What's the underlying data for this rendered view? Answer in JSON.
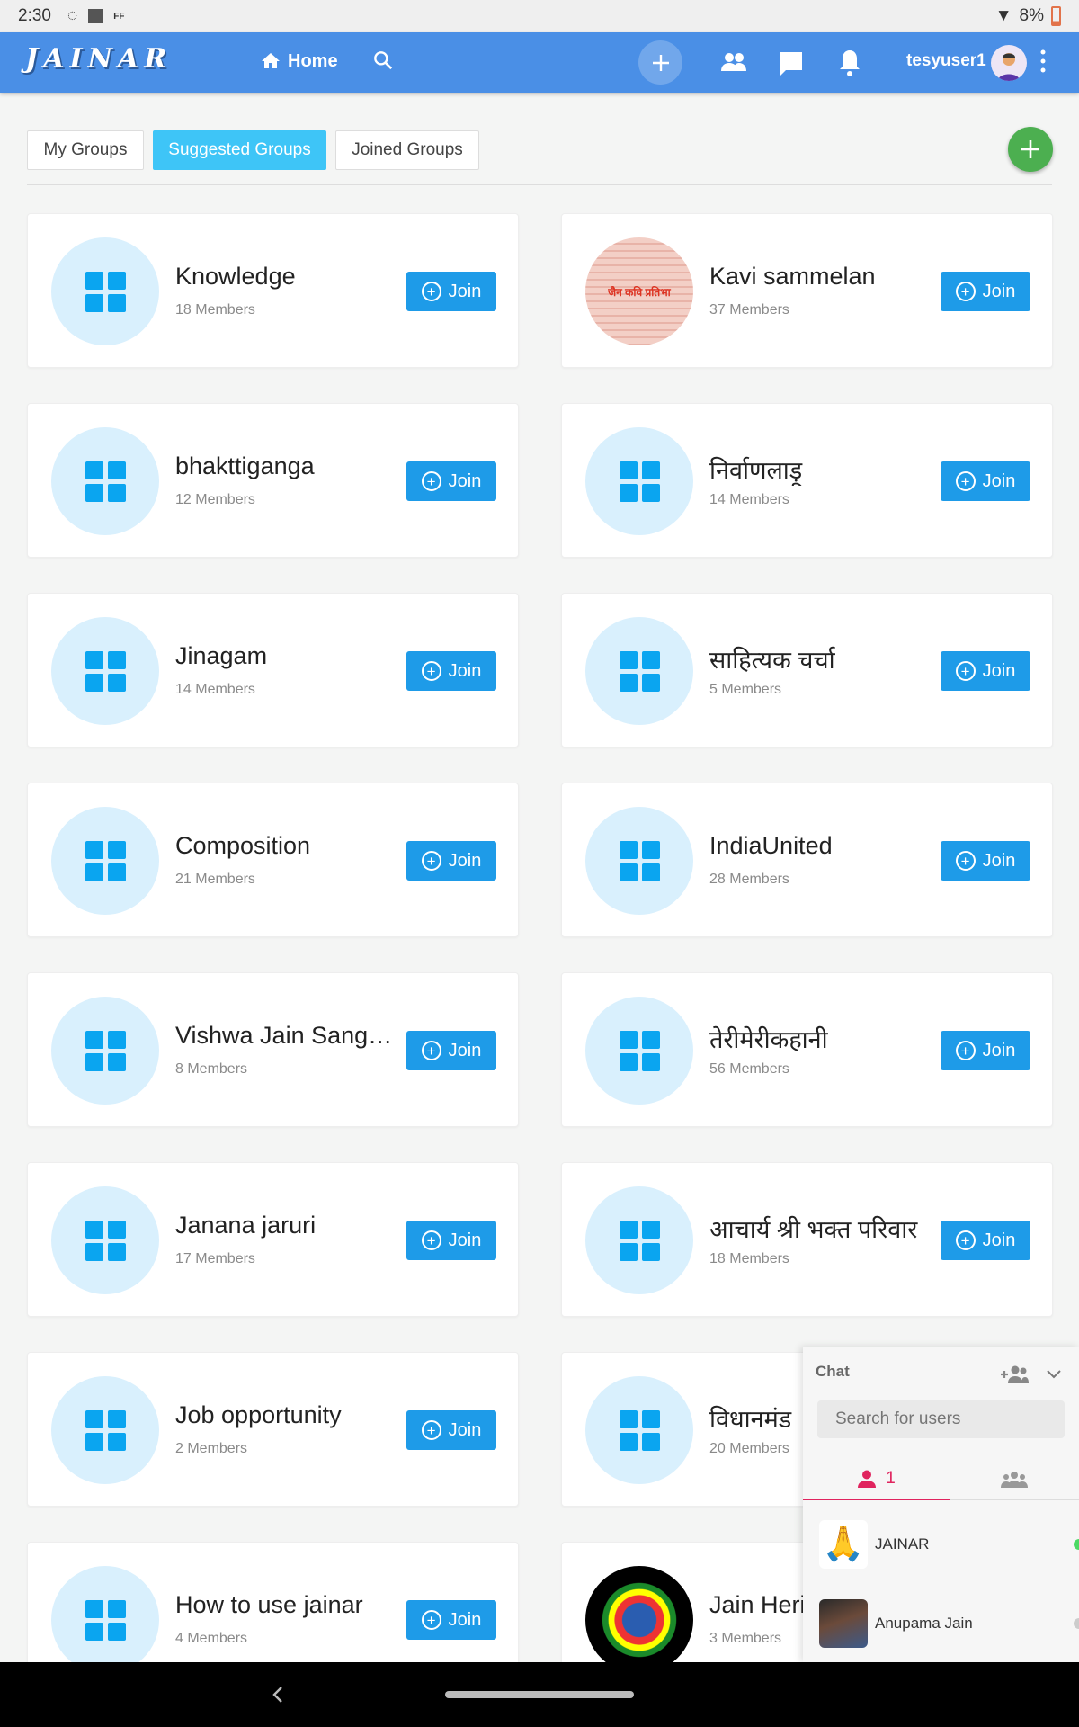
{
  "status_bar": {
    "time": "2:30",
    "battery": "8%",
    "notif_label": "FF"
  },
  "header": {
    "logo": "JAINAR",
    "home": "Home",
    "username": "tesyuser1"
  },
  "tabs": [
    {
      "label": "My Groups",
      "active": false
    },
    {
      "label": "Suggested Groups",
      "active": true
    },
    {
      "label": "Joined Groups",
      "active": false
    }
  ],
  "join_label": "Join",
  "groups": [
    {
      "name": "Knowledge",
      "members": "18 Members",
      "avatar": "grid"
    },
    {
      "name": "Kavi sammelan",
      "members": "37 Members",
      "avatar": "poster",
      "avatar_text": "जैन कवि प्रतिभा"
    },
    {
      "name": "bhakttiganga",
      "members": "12 Members",
      "avatar": "grid"
    },
    {
      "name": "निर्वाणलाड़ू",
      "members": "14 Members",
      "avatar": "grid"
    },
    {
      "name": "Jinagam",
      "members": "14 Members",
      "avatar": "grid"
    },
    {
      "name": "साहित्यक चर्चा",
      "members": "5 Members",
      "avatar": "grid"
    },
    {
      "name": "Composition",
      "members": "21 Members",
      "avatar": "grid"
    },
    {
      "name": "IndiaUnited",
      "members": "28 Members",
      "avatar": "grid"
    },
    {
      "name": "Vishwa Jain Sangat…",
      "members": "8 Members",
      "avatar": "grid"
    },
    {
      "name": "तेरीमेरीकहानी",
      "members": "56 Members",
      "avatar": "grid"
    },
    {
      "name": "Janana jaruri",
      "members": "17 Members",
      "avatar": "grid"
    },
    {
      "name": "आचार्य श्री भक्त परिवार",
      "members": "18 Members",
      "avatar": "grid"
    },
    {
      "name": "Job opportunity",
      "members": "2 Members",
      "avatar": "grid"
    },
    {
      "name": "विधानमंड",
      "members": "20 Members",
      "avatar": "grid"
    },
    {
      "name": "How to use jainar",
      "members": "4 Members",
      "avatar": "grid"
    },
    {
      "name": "Jain Heri",
      "members": "3 Members",
      "avatar": "emblem"
    }
  ],
  "chat": {
    "title": "Chat",
    "search_placeholder": "Search for users",
    "online_count": "1",
    "users": [
      {
        "name": "JAINAR",
        "online": true,
        "status_color": "#4cd964"
      },
      {
        "name": "Anupama Jain",
        "online": false,
        "status_color": "#cccccc"
      }
    ]
  },
  "colors": {
    "header": "#4a8fe6",
    "join": "#1e9be8",
    "active_tab": "#3ec5f7",
    "fab": "#4caf50",
    "chat_accent": "#e0245e"
  }
}
